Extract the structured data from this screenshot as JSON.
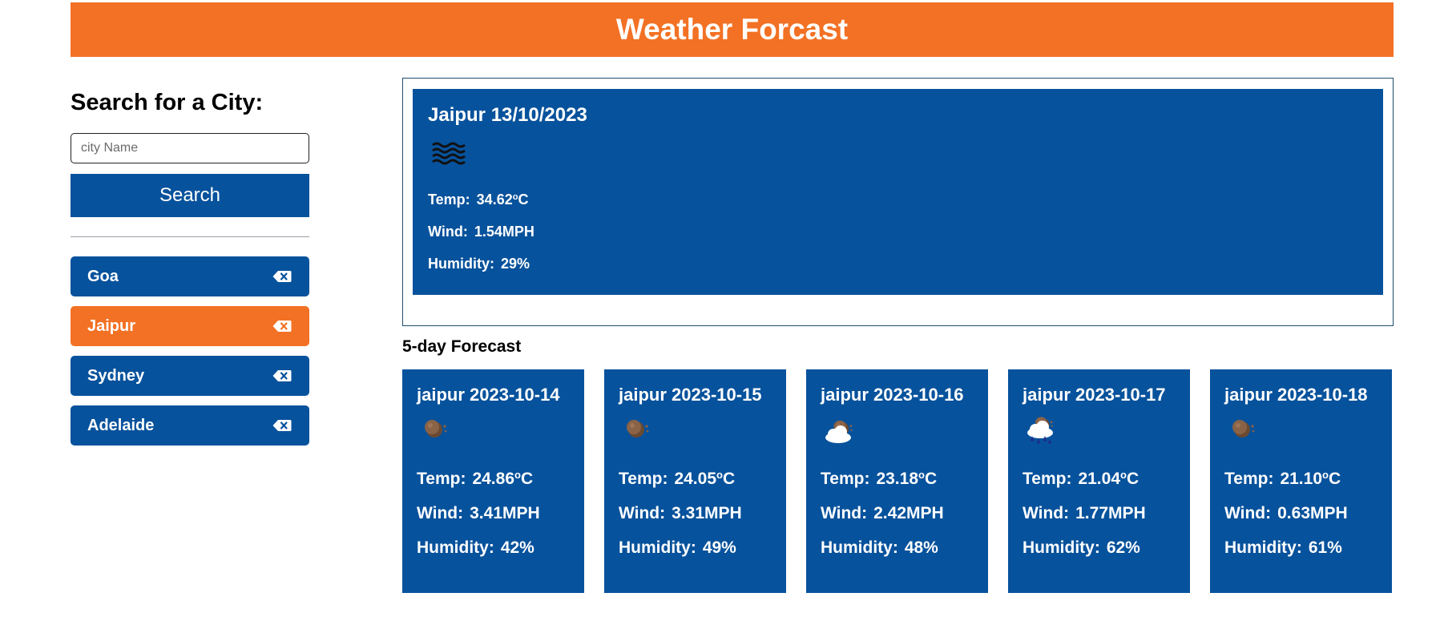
{
  "header": {
    "title": "Weather Forcast"
  },
  "search": {
    "title": "Search for a City:",
    "placeholder": "city Name",
    "value": "",
    "button_label": "Search"
  },
  "history": [
    {
      "label": "Goa",
      "active": false
    },
    {
      "label": "Jaipur",
      "active": true
    },
    {
      "label": "Sydney",
      "active": false
    },
    {
      "label": "Adelaide",
      "active": false
    }
  ],
  "current": {
    "title": "Jaipur 13/10/2023",
    "icon": "mist-icon",
    "temp_label": "Temp:",
    "temp_value": "34.62",
    "temp_degree": "o",
    "temp_unit": "C",
    "wind_label": "Wind:",
    "wind_value": "1.54MPH",
    "humidity_label": "Humidity:",
    "humidity_value": "29%"
  },
  "forecast": {
    "title": "5-day Forecast",
    "days": [
      {
        "title": "jaipur 2023-10-14",
        "icon": "clear-night-icon",
        "temp_label": "Temp:",
        "temp_value": "24.86",
        "temp_degree": "o",
        "temp_unit": "C",
        "wind_label": "Wind:",
        "wind_value": "3.41MPH",
        "humidity_label": "Humidity:",
        "humidity_value": "42%"
      },
      {
        "title": "jaipur 2023-10-15",
        "icon": "clear-night-icon",
        "temp_label": "Temp:",
        "temp_value": "24.05",
        "temp_degree": "o",
        "temp_unit": "C",
        "wind_label": "Wind:",
        "wind_value": "3.31MPH",
        "humidity_label": "Humidity:",
        "humidity_value": "49%"
      },
      {
        "title": "jaipur 2023-10-16",
        "icon": "cloudy-night-icon",
        "temp_label": "Temp:",
        "temp_value": "23.18",
        "temp_degree": "o",
        "temp_unit": "C",
        "wind_label": "Wind:",
        "wind_value": "2.42MPH",
        "humidity_label": "Humidity:",
        "humidity_value": "48%"
      },
      {
        "title": "jaipur 2023-10-17",
        "icon": "rain-night-icon",
        "temp_label": "Temp:",
        "temp_value": "21.04",
        "temp_degree": "o",
        "temp_unit": "C",
        "wind_label": "Wind:",
        "wind_value": "1.77MPH",
        "humidity_label": "Humidity:",
        "humidity_value": "62%"
      },
      {
        "title": "jaipur 2023-10-18",
        "icon": "clear-night-icon",
        "temp_label": "Temp:",
        "temp_value": "21.10",
        "temp_degree": "o",
        "temp_unit": "C",
        "wind_label": "Wind:",
        "wind_value": "0.63MPH",
        "humidity_label": "Humidity:",
        "humidity_value": "61%"
      }
    ]
  },
  "colors": {
    "primary": "#07529c",
    "accent": "#f37124",
    "text_light": "#ffffff"
  }
}
